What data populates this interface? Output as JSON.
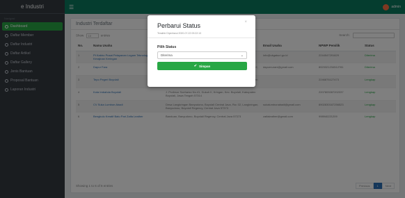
{
  "app": {
    "brand": "e Industri"
  },
  "sidebar": {
    "heading": "Navigasi",
    "items": [
      {
        "label": "Dashboard",
        "active": true
      },
      {
        "label": "Daftar Member"
      },
      {
        "label": "Daftar Industri"
      },
      {
        "label": "Daftar Artikel"
      },
      {
        "label": "Daftar Gallery"
      },
      {
        "label": "Jenis Bantuan"
      },
      {
        "label": "Proposal Bantuan"
      },
      {
        "label": "Laporan Industri"
      }
    ]
  },
  "topbar": {
    "menu_icon": "☰",
    "user": "admin"
  },
  "card": {
    "title": "Industri Terdaftar",
    "show_label": "Show",
    "show_value": "10",
    "entries_label": "entries",
    "search_label": "Search:"
  },
  "table": {
    "headers": [
      "No.",
      "Nama Usaha",
      "Alamat",
      "Email Usaha",
      "NPWP Pemilik",
      "Status"
    ],
    "rows": [
      {
        "no": "1",
        "nama": "Pt Kabiro Pusat Pelayanan Logam Teknologi dan Kerajinan Keringan",
        "alamat": "Jl. Raya Wates, Banyudono, Kabupaten Boyolali,",
        "email": "info@ukgakuri.go.id",
        "npwp": "2244547291829",
        "status": "Diterima"
      },
      {
        "no": "2",
        "nama": "Dapur Fara",
        "alamat": "Dukuh pentingan, Ganiran, Sela, Kabupaten Boyolali, Jawa Tengah 57302, Indonesia",
        "email": "dapurnurani@gmail.com",
        "npwp": "8923321234512781",
        "status": "Diterima"
      },
      {
        "no": "3",
        "nama": "Tepo Pegeri Boyolali",
        "alamat": "Jl. Pangeran Diponegoro No.28, Sayuran, Ngaki, Kec. Boyolali, Kabupaten Boyolali, Jawa Tengah 57313",
        "email": "",
        "npwp": "2246876127473",
        "status": "Lengkap"
      },
      {
        "no": "4",
        "nama": "Kota Imbahda Boyolali",
        "alamat": "J. Profesor Soeharso No.41, Dukuh II, Kringan, Kec. Boyolali, Kabupaten Boyolali, Jawa Tengah 57314",
        "email": "",
        "npwp": "2207809287202337",
        "status": "Lengkap"
      },
      {
        "no": "5",
        "nama": "CV Suka Lumbon Abadi",
        "alamat": "Desa Langkringan Banyudono, Boyolali Central Java, Rw. 02, Langkringan, Banyudono, Boyolali Regency, Central Java 57373",
        "email": "sukalumbonabadi@gmail.com",
        "npwp": "8902830187256523",
        "status": "Lengkap"
      },
      {
        "no": "6",
        "nama": "Bengkulu Kreatif Batu Pari Zaifa Leather",
        "alamat": "Banduan, Banyudono, Boyolali Regency, Central Java 57373",
        "email": "zaifaleather@gmail.com",
        "npwp": "998940221209",
        "status": "Lengkap"
      }
    ]
  },
  "footer": {
    "info": "Showing 1 to 6 of 6 entries",
    "prev": "Previous",
    "page": "1",
    "next": "Next"
  },
  "modal": {
    "title": "Perbarui Status",
    "subtitle": "Terakhir Diperbarui 2020-07-22 09:22:13",
    "close": "×",
    "field_label": "Pilih Status",
    "selected": "Diterima",
    "button_label": "Simpan",
    "button_icon": "✔"
  },
  "colors": {
    "sidebar": "#343a40",
    "topbar": "#0b7a5e",
    "accent": "#28a745",
    "link": "#2a6fb5"
  }
}
